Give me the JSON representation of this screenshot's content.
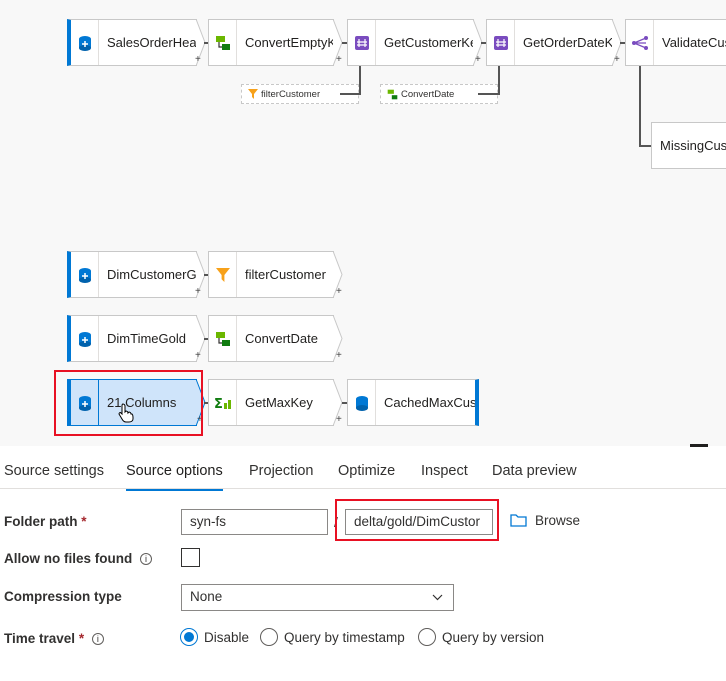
{
  "flow": {
    "nodes": {
      "sales_order": "SalesOrderHea...",
      "convert_empty": "ConvertEmptyK...",
      "get_customer_key": "GetCustomerKey",
      "get_order_date_key": "GetOrderDateKey",
      "validate_customer": "ValidateCusto",
      "missing_customer": "MissingCusto",
      "dim_customer": "DimCustomerG...",
      "filter_customer": "filterCustomer",
      "dim_time": "DimTimeGold",
      "convert_date": "ConvertDate",
      "columns_source": "21 Columns",
      "get_max_key": "GetMaxKey",
      "cached_max": "CachedMaxCust..."
    },
    "refs": {
      "filter_customer_ref": "filterCustomer",
      "convert_date_ref": "ConvertDate"
    },
    "plus": "+"
  },
  "tabs": [
    "Source settings",
    "Source options",
    "Projection",
    "Optimize",
    "Inspect",
    "Data preview"
  ],
  "form": {
    "folder_path_label": "Folder path",
    "required_mark": "*",
    "container_value": "syn-fs",
    "separator": "/",
    "directory_value": "delta/gold/DimCustor",
    "browse_label": "Browse",
    "allow_no_files_label": "Allow no files found",
    "compression_label": "Compression type",
    "compression_value": "None",
    "time_travel_label": "Time travel",
    "time_travel_options": [
      "Disable",
      "Query by timestamp",
      "Query by version"
    ]
  },
  "colors": {
    "accent": "#0078d4",
    "highlight": "#e81123",
    "filter_icon": "#f7a11a",
    "join_icon": "#7a4cbf",
    "derive_icon": "#6bb700"
  }
}
